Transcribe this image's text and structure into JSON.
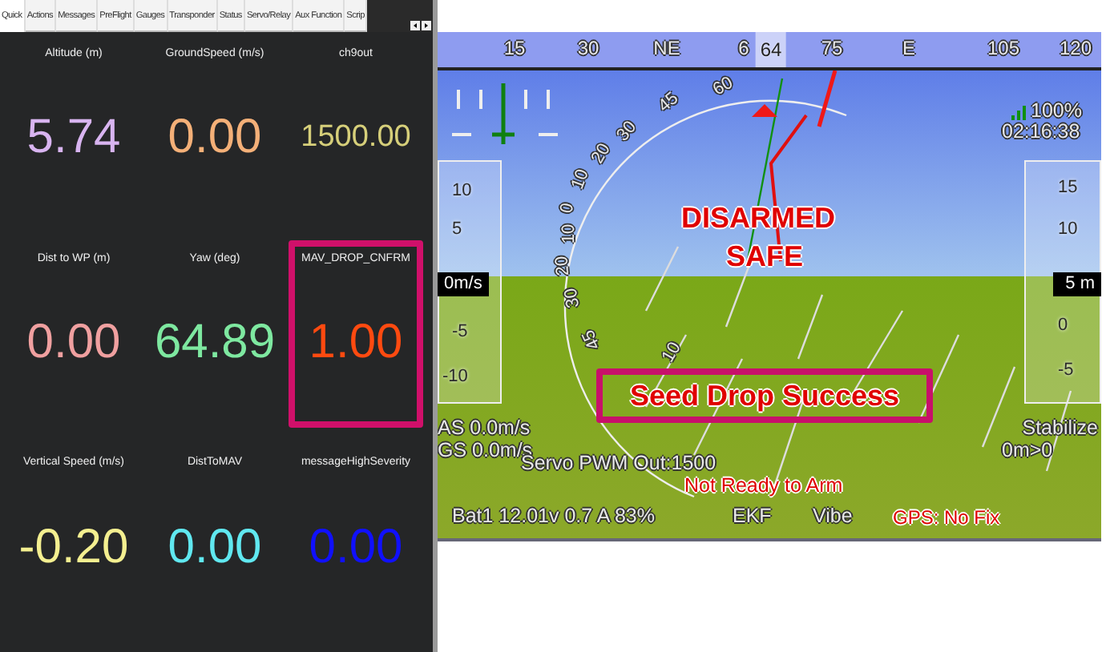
{
  "tabs": [
    {
      "label": "Quick",
      "selected": true
    },
    {
      "label": "Actions",
      "selected": false
    },
    {
      "label": "Messages",
      "selected": false
    },
    {
      "label": "PreFlight",
      "selected": false
    },
    {
      "label": "Gauges",
      "selected": false
    },
    {
      "label": "Transponder",
      "selected": false
    },
    {
      "label": "Status",
      "selected": false
    },
    {
      "label": "Servo/Relay",
      "selected": false
    },
    {
      "label": "Aux Function",
      "selected": false
    },
    {
      "label": "Scrip",
      "selected": false
    }
  ],
  "quick": [
    {
      "label": "Altitude (m)",
      "value": "5.74",
      "color": "#d8b4f0",
      "highlighted": false
    },
    {
      "label": "GroundSpeed (m/s)",
      "value": "0.00",
      "color": "#f4b078",
      "highlighted": false
    },
    {
      "label": "ch9out",
      "value": "1500.00",
      "color": "#d6cf7a",
      "highlighted": false
    },
    {
      "label": "Dist to WP (m)",
      "value": "0.00",
      "color": "#f0a0a0",
      "highlighted": false
    },
    {
      "label": "Yaw (deg)",
      "value": "64.89",
      "color": "#7ee8a0",
      "highlighted": false
    },
    {
      "label": "MAV_DROP_CNFRM",
      "value": "1.00",
      "color": "#ff4a10",
      "highlighted": true
    },
    {
      "label": "Vertical Speed (m/s)",
      "value": "-0.20",
      "color": "#f4ef90",
      "highlighted": false
    },
    {
      "label": "DistToMAV",
      "value": "0.00",
      "color": "#60e8f0",
      "highlighted": false
    },
    {
      "label": "messageHighSeverity",
      "value": "0.00",
      "color": "#1010ff",
      "highlighted": false
    }
  ],
  "hud": {
    "heading_ticks": [
      "15",
      "30",
      "NE",
      "6",
      "75",
      "E",
      "105",
      "120"
    ],
    "heading": "64",
    "roll_labels": [
      "60",
      "45",
      "30",
      "20",
      "10",
      "0",
      "10",
      "20",
      "30",
      "45"
    ],
    "pitch_labels": [
      "10"
    ],
    "battery_percent": "100%",
    "time": "02:16:38",
    "speed_tape": [
      "10",
      "5",
      "-5",
      "-10"
    ],
    "speed_readout": "0m/s",
    "altitude_tape": [
      "15",
      "10",
      "0",
      "-5"
    ],
    "altitude_readout": "5 m",
    "status_lines": [
      "DISARMED",
      "SAFE"
    ],
    "message": {
      "text": "Seed Drop Success",
      "highlighted": true
    },
    "airspeed": "AS 0.0m/s",
    "groundspeed": "GS 0.0m/s",
    "servo": "Servo PWM Out:1500",
    "arm_status": "Not Ready to Arm",
    "battery": "Bat1 12.01v 0.7 A 83%",
    "ekf": "EKF",
    "vibe": "Vibe",
    "gps": "GPS: No Fix",
    "mode": "Stabilize",
    "distance": "0m>0"
  }
}
